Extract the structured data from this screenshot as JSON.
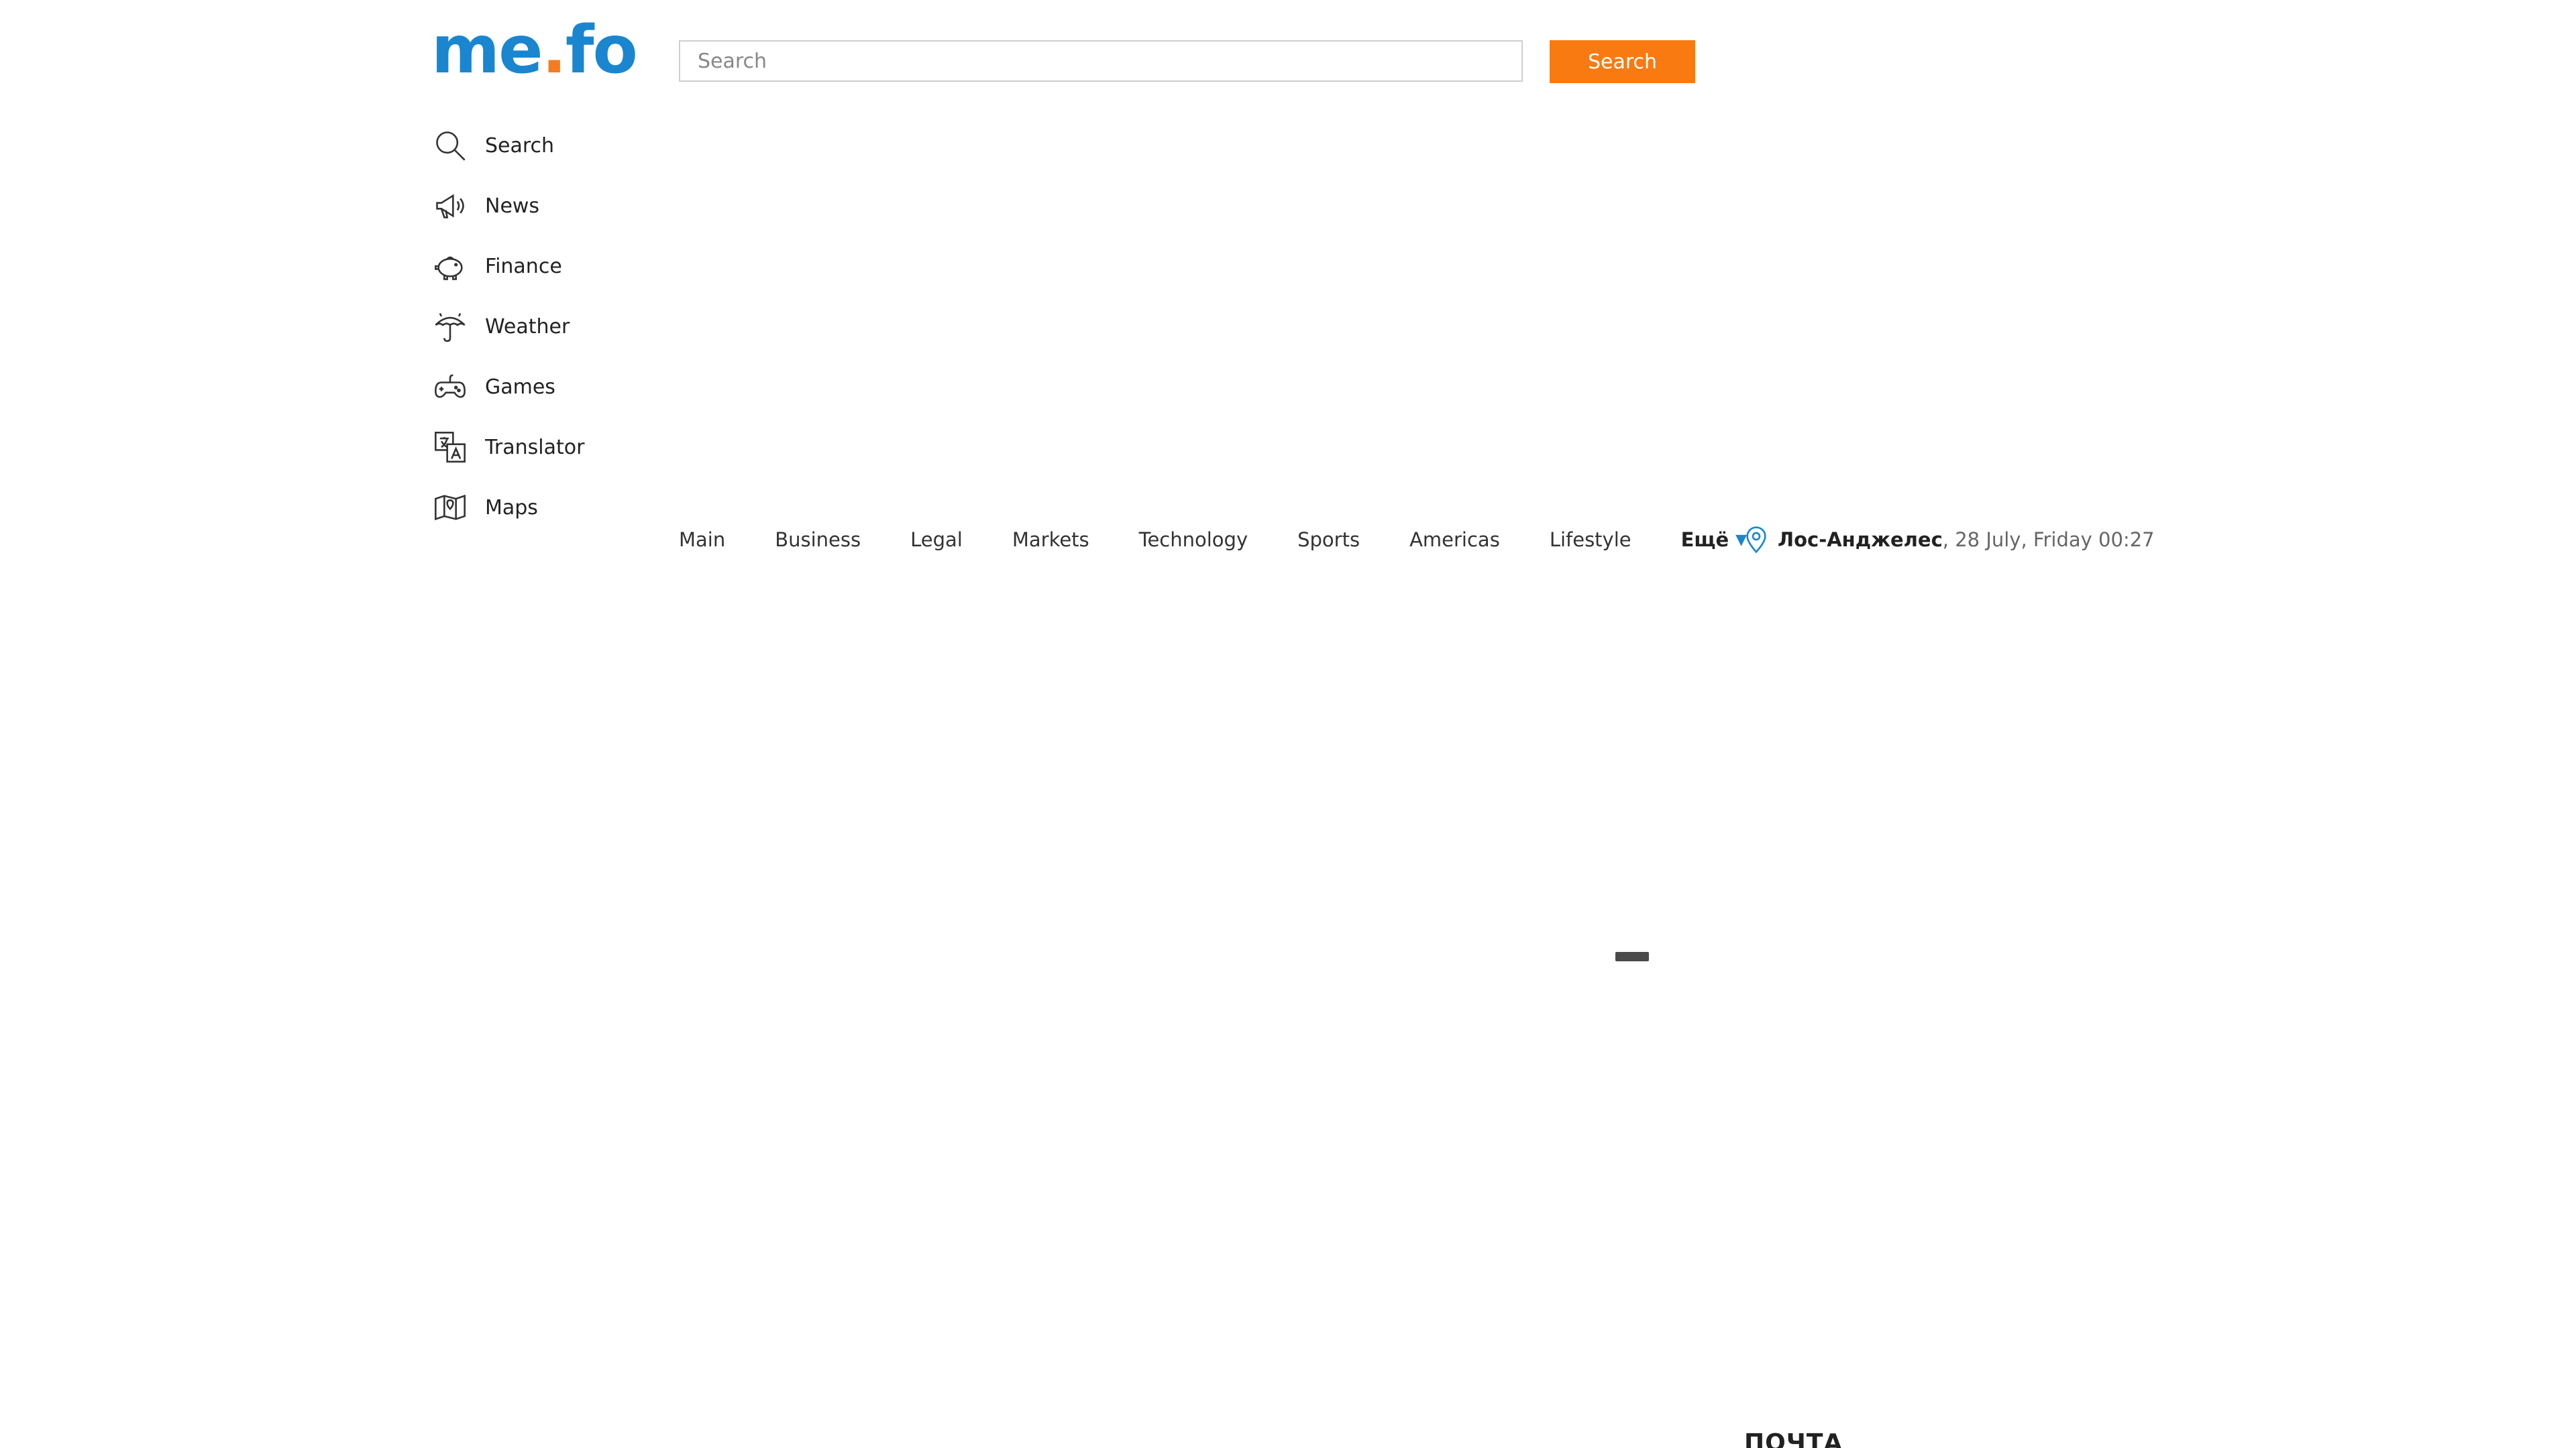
{
  "header": {
    "logo": {
      "part1": "me",
      "dot": ".",
      "part2": "fo"
    },
    "search": {
      "placeholder": "Search",
      "value": "",
      "button_label": "Search"
    }
  },
  "sidebar": {
    "items": [
      {
        "label": "Search",
        "icon": "search-icon"
      },
      {
        "label": "News",
        "icon": "megaphone-icon"
      },
      {
        "label": "Finance",
        "icon": "piggy-bank-icon"
      },
      {
        "label": "Weather",
        "icon": "umbrella-icon"
      },
      {
        "label": "Games",
        "icon": "gamepad-icon"
      },
      {
        "label": "Translator",
        "icon": "translate-icon"
      },
      {
        "label": "Maps",
        "icon": "map-icon"
      }
    ]
  },
  "topnav": {
    "items": [
      "Main",
      "Business",
      "Legal",
      "Markets",
      "Technology",
      "Sports",
      "Americas",
      "Lifestyle"
    ],
    "more_label": "Ещё",
    "more_caret": "▼"
  },
  "location": {
    "city": "Лос-Анджелес",
    "datetime": ", 28 July, Friday 00:27"
  },
  "mail": {
    "heading": "ПОЧТА"
  },
  "colors": {
    "brand_blue": "#1a86d0",
    "brand_orange": "#f57b1e",
    "search_button": "#f97a10"
  }
}
